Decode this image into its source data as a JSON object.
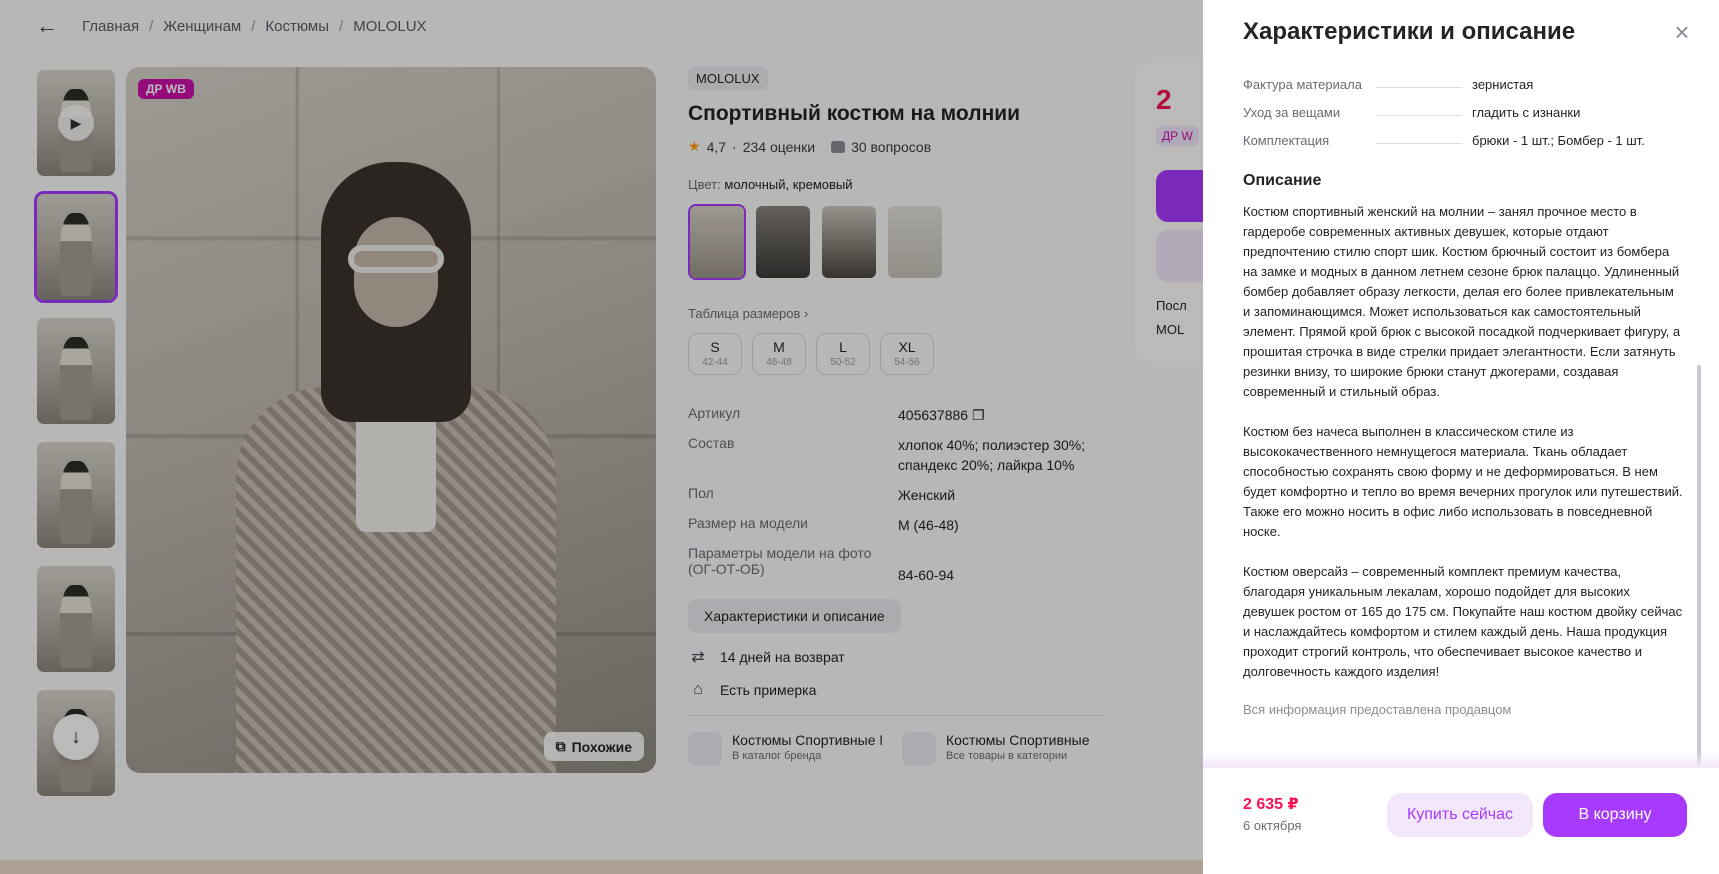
{
  "breadcrumb": {
    "items": [
      "Главная",
      "Женщинам",
      "Костюмы",
      "MOLOLUX"
    ],
    "separator": "/"
  },
  "gallery": {
    "badge": "ДР WB",
    "similar_label": "Похожие",
    "thumbnail_count": 6,
    "active_thumbnail": 2
  },
  "product": {
    "brand": "MOLOLUX",
    "title": "Спортивный костюм на молнии",
    "rating": "4,7",
    "rating_sep": "·",
    "reviews": "234 оценки",
    "questions": "30 вопросов",
    "color_label": "Цвет:",
    "color_value": "молочный, кремовый",
    "size_table_label": "Таблица размеров",
    "sizes": [
      {
        "name": "S",
        "range": "42-44"
      },
      {
        "name": "M",
        "range": "46-48"
      },
      {
        "name": "L",
        "range": "50-52"
      },
      {
        "name": "XL",
        "range": "54-56"
      }
    ],
    "params": [
      {
        "key": "Артикул",
        "value": "405637886"
      },
      {
        "key": "Состав",
        "value": "хлопок 40%; полиэстер 30%; спандекс 20%; лайкра 10%"
      },
      {
        "key": "Пол",
        "value": "Женский"
      },
      {
        "key": "Размер на модели",
        "value": "M (46-48)"
      },
      {
        "key": "Параметры модели на фото (ОГ-ОТ-ОБ)",
        "value": "84-60-94"
      }
    ],
    "char_button": "Характеристики и описание",
    "perks": [
      "14 дней на возврат",
      "Есть примерка"
    ],
    "categories": [
      {
        "title": "Костюмы Спортивные MOLOLUX",
        "subtitle": "В каталог бренда"
      },
      {
        "title": "Костюмы Спортивные",
        "subtitle": "Все товары в категории"
      }
    ]
  },
  "price_card": {
    "price_partial": "2",
    "badge_partial": "ДР W",
    "line1_partial": "Посл",
    "line2_partial": "MOL"
  },
  "drawer": {
    "title": "Характеристики и описание",
    "specs": [
      {
        "key": "Фактура материала",
        "value": "зернистая"
      },
      {
        "key": "Уход за вещами",
        "value": "гладить с изнанки"
      },
      {
        "key": "Комплектация",
        "value": "брюки - 1 шт.; Бомбер - 1 шт."
      }
    ],
    "description_heading": "Описание",
    "paragraphs": [
      "Костюм спортивный женский на молнии – занял прочное место в гардеробе современных активных девушек, которые отдают предпочтению стилю спорт шик. Костюм брючный состоит из бомбера на замке и модных в данном летнем сезоне брюк палаццо. Удлиненный бомбер добавляет образу легкости, делая его более привлекательным и запоминающимся. Может использоваться как самостоятельный элемент. Прямой крой брюк с высокой посадкой подчеркивает фигуру, а прошитая строчка в виде стрелки придает элегантности. Если затянуть резинки внизу, то широкие брюки станут джогерами, создавая современный и стильный образ.",
      "Костюм без начеса выполнен в классическом стиле из высококачественного немнущегося материала. Ткань обладает способностью сохранять свою форму и не деформироваться. В нем будет комфортно и тепло во время вечерних прогулок или путешествий. Также его можно носить в офис либо использовать в повседневной носке.",
      "Костюм оверсайз – современный комплект премиум качества, благодаря уникальным лекалам, хорошо подойдет для высоких девушек ростом от 165 до 175 см. Покупайте наш костюм двойку сейчас и наслаждайтесь комфортом и стилем каждый день. Наша продукция проходит строгий контроль, что обеспечивает высокое качество и долговечность каждого изделия!"
    ],
    "seller_note": "Вся информация предоставлена продавцом",
    "footer": {
      "price": "2 635 ₽",
      "delivery_date": "6 октября",
      "buy_now": "Купить сейчас",
      "to_cart": "В корзину"
    }
  },
  "colors": {
    "accent": "#a73afd",
    "accent_light": "#f3e8fb",
    "price": "#f91155",
    "badge": "#cb11ab"
  }
}
